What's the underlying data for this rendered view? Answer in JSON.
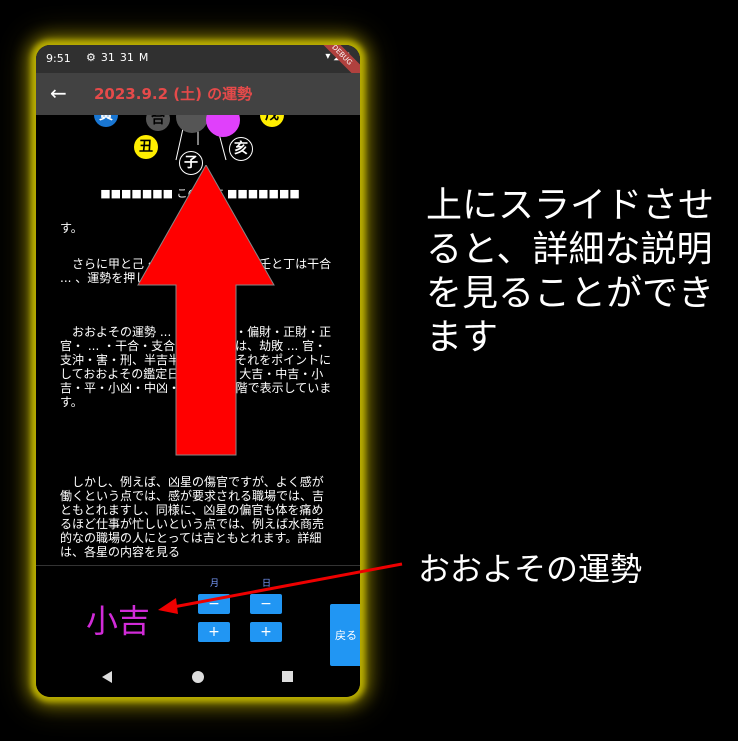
{
  "status": {
    "time": "9:51",
    "icons": [
      "⚙",
      "31",
      "31",
      "M"
    ],
    "debug": "DEBUG"
  },
  "appbar": {
    "title": "2023.9.2 (土) の運勢"
  },
  "chart": {
    "k1": "寅",
    "k2": "合",
    "k3": "戌",
    "k4": "丑",
    "k5": "子",
    "k6": "亥"
  },
  "section_header": "■■■■■■■ この... 方 ■■■■■■■",
  "paragraphs": [
    "す。",
    "さらに甲と己・ ... と癸・庚と乙・壬と丁は干合 ... 、運勢を押しあげます。",
    "おおよその運勢 ... 吉は、食神・偏財・正財・正官・ ... ・干合・支合・三合、凶は、劫敗 ... 官・支沖・害・刑、半吉半凶は、 ... それをポイントにしておおよその鑑定日の運勢を、大吉・中吉・小吉・平・小凶・中凶・大凶の7段階で表示しています。",
    "しかし、例えば、凶星の傷官ですが、よく感が働くという点では、感が要求される職場では、吉ともとれますし、同様に、凶星の偏官も体を痛めるほど仕事が忙しいという点では、例えば水商売的なの職場の人にとっては吉ともとれます。詳細は、各星の内容を見る"
  ],
  "bottom": {
    "fortune": "小吉",
    "month_label": "月",
    "day_label": "日",
    "minus": "−",
    "plus": "+",
    "back": "戻る"
  },
  "annotations": {
    "swipe_note": "上にスライドさせると、詳細な説明を見ることができます",
    "fortune_note": "おおよその運勢"
  },
  "colors": {
    "accent_red": "#e54a4a",
    "fortune": "#d12bd8",
    "button": "#2196f3",
    "glow": "#b8ad00"
  }
}
